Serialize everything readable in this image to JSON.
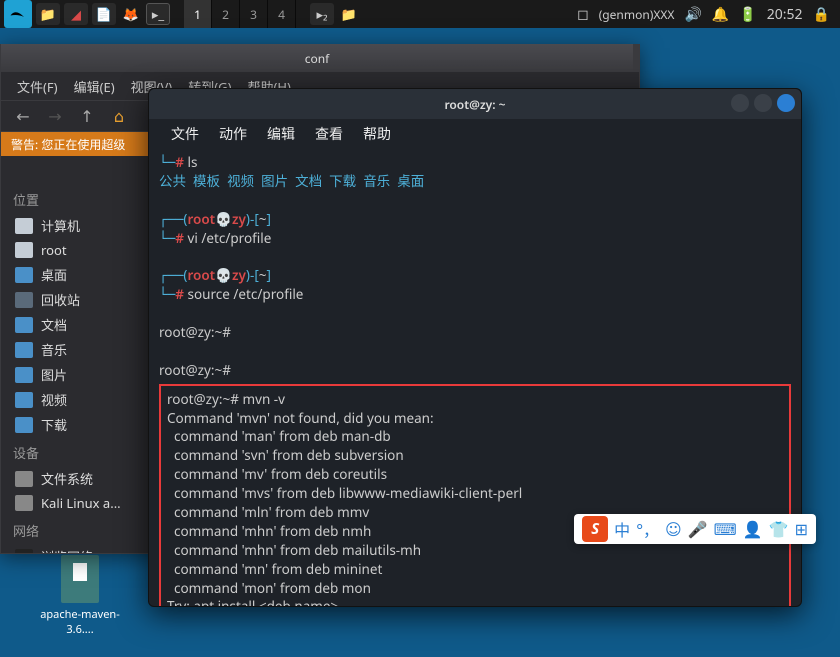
{
  "taskbar": {
    "workspaces": [
      "1",
      "2",
      "3",
      "4"
    ],
    "active_ws": 0,
    "genmon": "(genmon)XXX",
    "time": "20:52"
  },
  "desktop": {
    "file": "apache-maven-3.6...."
  },
  "fm": {
    "title": "conf",
    "menu": [
      "文件(F)",
      "编辑(E)",
      "视图(V)",
      "转到(G)",
      "帮助(H)"
    ],
    "warning": "警告: 您正在使用超级",
    "sections": {
      "places": "位置",
      "devices": "设备",
      "network": "网络"
    },
    "places": [
      "计算机",
      "root",
      "桌面",
      "回收站",
      "文档",
      "音乐",
      "图片",
      "视频",
      "下载"
    ],
    "devices": [
      "文件系统",
      "Kali Linux a..."
    ],
    "network": [
      "浏览网络"
    ]
  },
  "term": {
    "title": "root@zy: ~",
    "menu": [
      "文件",
      "动作",
      "编辑",
      "查看",
      "帮助"
    ],
    "user": "root",
    "host": "zy",
    "path": "~",
    "cmd_ls": "ls",
    "ls_out": [
      "公共",
      "模板",
      "视频",
      "图片",
      "文档",
      "下载",
      "音乐",
      "桌面"
    ],
    "cmd_vi": "vi /etc/profile",
    "cmd_src": "source /etc/profile",
    "plain_prompt": "root@zy:~#",
    "mvn_cmd": "mvn -v",
    "mvn_out": [
      "Command 'mvn' not found, did you mean:",
      "  command 'man' from deb man-db",
      "  command 'svn' from deb subversion",
      "  command 'mv' from deb coreutils",
      "  command 'mvs' from deb libwww-mediawiki-client-perl",
      "  command 'mln' from deb mmv",
      "  command 'mhn' from deb nmh",
      "  command 'mhn' from deb mailutils-mh",
      "  command 'mn' from deb mininet",
      "  command 'mon' from deb mon",
      "Try: apt install <deb name>"
    ]
  },
  "ime": {
    "letter": "S",
    "lang": "中"
  }
}
